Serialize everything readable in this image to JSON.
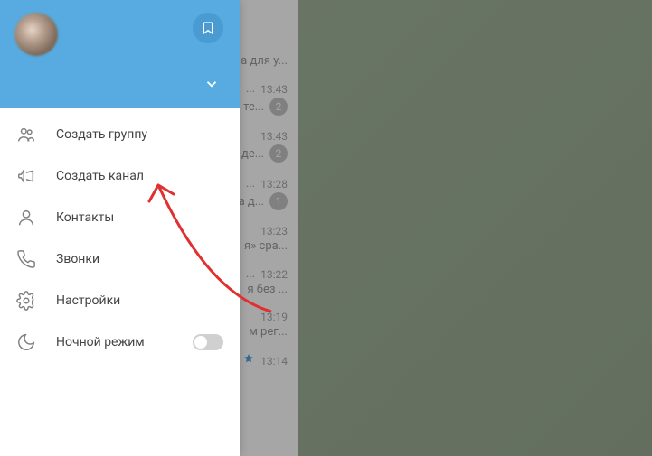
{
  "drawer": {
    "menu": [
      {
        "id": "new-group",
        "icon": "group",
        "label": "Создать группу"
      },
      {
        "id": "new-channel",
        "icon": "megaphone",
        "label": "Создать канал"
      },
      {
        "id": "contacts",
        "icon": "person",
        "label": "Контакты"
      },
      {
        "id": "calls",
        "icon": "phone",
        "label": "Звонки"
      },
      {
        "id": "settings",
        "icon": "gear",
        "label": "Настройки"
      },
      {
        "id": "night-mode",
        "icon": "moon",
        "label": "Ночной режим",
        "toggle": true,
        "toggle_on": false
      }
    ]
  },
  "chat_list": [
    {
      "snippet": "а для у...",
      "time": "",
      "badge": null
    },
    {
      "snippet": "...",
      "time": "13:43",
      "badge": null
    },
    {
      "snippet": "те...",
      "time": "",
      "badge": "2"
    },
    {
      "snippet": "",
      "time": "13:43",
      "badge": null
    },
    {
      "snippet": "де...",
      "time": "",
      "badge": "2"
    },
    {
      "snippet": "...",
      "time": "13:28",
      "badge": null
    },
    {
      "snippet": "а д...",
      "time": "",
      "badge": "1"
    },
    {
      "snippet": "",
      "time": "13:23",
      "badge": null
    },
    {
      "snippet": "я» сра...",
      "time": "",
      "badge": null
    },
    {
      "snippet": "...",
      "time": "13:22",
      "badge": null
    },
    {
      "snippet": "я без ...",
      "time": "",
      "badge": null
    },
    {
      "snippet": "",
      "time": "13:19",
      "badge": null
    },
    {
      "snippet": "м рег...",
      "time": "",
      "badge": null
    },
    {
      "snippet": "",
      "time": "13:14",
      "badge": null,
      "verified": true
    }
  ]
}
